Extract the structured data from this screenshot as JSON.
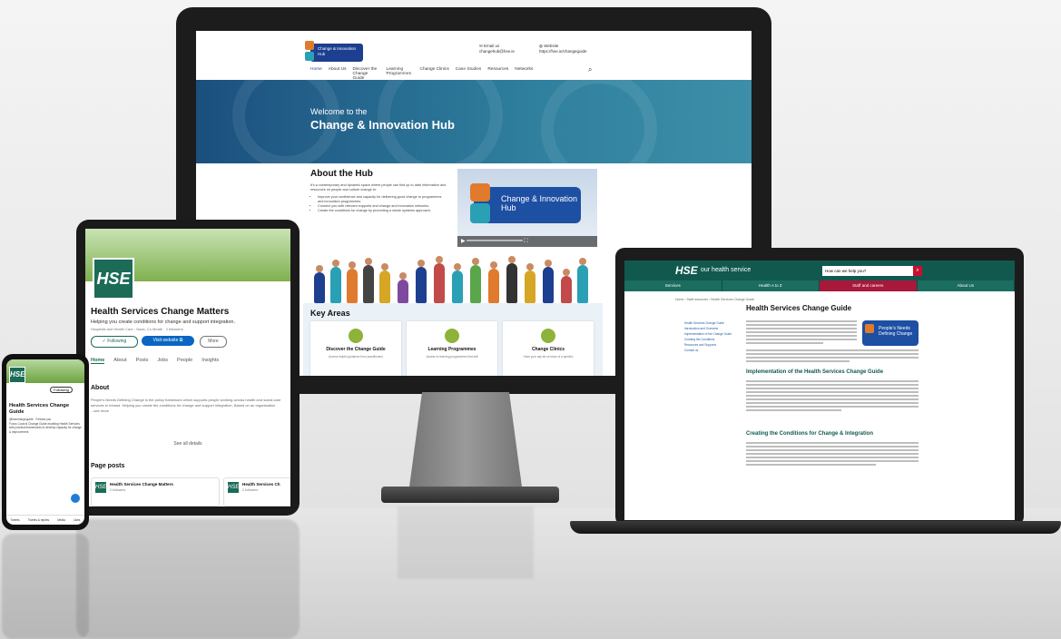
{
  "monitor": {
    "logo": "Change & Innovation Hub",
    "email_label": "Email us",
    "email_value": "changehub@hse.ie",
    "website_label": "Website",
    "website_value": "https://hse.ie/changeguide",
    "nav": [
      "Home",
      "About Us",
      "Discover the Change Guide",
      "Learning Programmes",
      "Change Clinics",
      "Case Studies",
      "Resources",
      "Networks"
    ],
    "hero_sub": "Welcome to the",
    "hero_title": "Change & Innovation Hub",
    "about_title": "About the Hub",
    "about_text": "It's a contemporary and dynamic space where people can find up to date information and resources on people and culture change to:",
    "bullets": [
      "Improve your confidence and capacity for delivering good change to programmes and innovation programmes.",
      "Connect you with relevant supports and change and innovation networks.",
      "Create the conditions for change by promoting a whole systems approach."
    ],
    "video_logo": "Change & Innovation Hub",
    "key_areas_title": "Key Areas",
    "cards": [
      {
        "label": "Discover the Change Guide",
        "sub": "Access helpful guidance from practitioners"
      },
      {
        "label": "Learning Programmes",
        "sub": "Access to learning programmes that self"
      },
      {
        "label": "Change Clinics",
        "sub": "Have your say let us know of a specific"
      }
    ]
  },
  "laptop": {
    "brand": "HSE",
    "brand_sub": "our health service",
    "search_placeholder": "How can we help you?",
    "menu": [
      "Services",
      "Health A to Z",
      "Staff and careers",
      "About Us"
    ],
    "breadcrumb": "Home › Staff resources › Health Services Change Guide",
    "title": "Health Services Change Guide",
    "badge": "People's Needs Defining Change",
    "sidebar": [
      "Health Services Change Guide",
      "Introduction and Overview",
      "Implementation of the Change Guide",
      "Creating the Conditions",
      "Resources and Supports",
      "Contact us"
    ],
    "h2_1": "Implementation of the Health Services Change Guide",
    "h2_2": "Creating the Conditions for Change & Integration"
  },
  "tablet": {
    "logo": "HSE",
    "page_name": "Health Services Change Matters",
    "tagline": "Helping you create conditions for change and support integration.",
    "meta": "Hospitals and Health Care · Naas, Co Meath · 2 followers",
    "following_label": "✓ Following",
    "visit_label": "Visit website ⧉",
    "more_label": "More",
    "tabs": [
      "Home",
      "About",
      "Posts",
      "Jobs",
      "People",
      "Insights"
    ],
    "about_title": "About",
    "about_text": "People's Needs Defining Change is the policy framework which supports people working across health and social care services in Ireland. Helping you create the conditions for change and support integration. Based on an organisation ...see more",
    "see_all": "See all details",
    "page_posts_title": "Page posts",
    "posts": [
      {
        "name": "Health Services Change Matters",
        "followers": "2 followers"
      },
      {
        "name": "Health Services Ch",
        "followers": "2 followers"
      }
    ]
  },
  "phone": {
    "logo": "HSE",
    "following": "Following",
    "title": "Health Services Change Guide",
    "handle": "@hsechangeguide · Follows you",
    "bio": "Focus Council Change Guide enabling Health Services with practical frameworks to develop capacity for change & improvement",
    "tabs": [
      "Tweets",
      "Tweets & replies",
      "Media",
      "Likes"
    ]
  },
  "colors": {
    "hse_green": "#11594e",
    "hub_blue": "#1d3f8f",
    "hse_red": "#a8183b"
  }
}
